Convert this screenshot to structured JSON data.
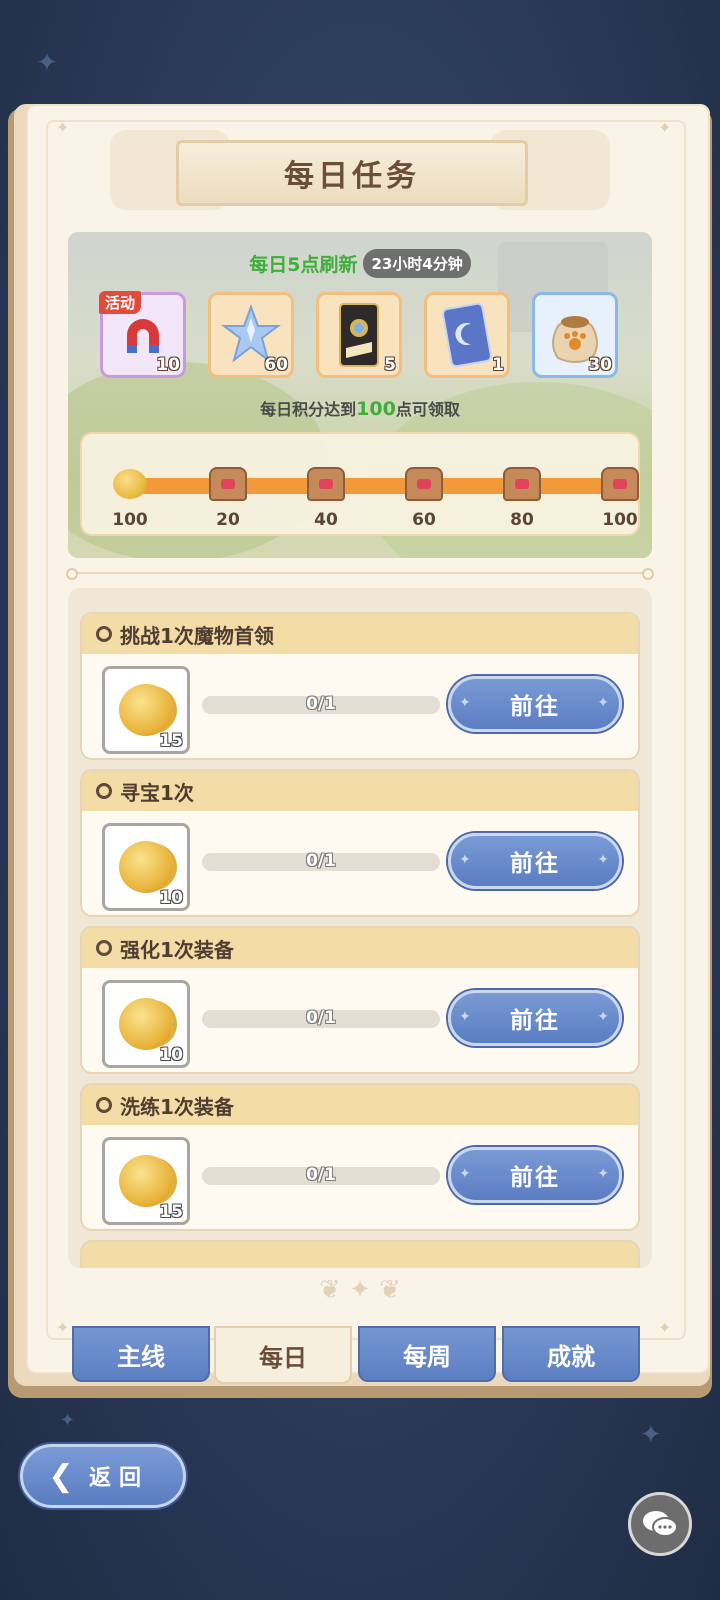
{
  "title": "每日任务",
  "refresh": {
    "text": "每日5点刷新",
    "timer": "23小时4分钟"
  },
  "rewards": [
    {
      "icon": "magnet-icon",
      "count": "10",
      "tag": "活动"
    },
    {
      "icon": "crystal-star-icon",
      "count": "60"
    },
    {
      "icon": "ticket-card-icon",
      "count": "5"
    },
    {
      "icon": "moon-card-icon",
      "count": "1"
    },
    {
      "icon": "paw-bag-icon",
      "count": "30"
    }
  ],
  "claim": {
    "prefix": "每日积分达到",
    "value": "100",
    "suffix": "点可领取"
  },
  "milestones": [
    {
      "label": "100",
      "icon": "coin-icon"
    },
    {
      "label": "20",
      "icon": "chest-icon"
    },
    {
      "label": "40",
      "icon": "chest-icon"
    },
    {
      "label": "60",
      "icon": "chest-icon"
    },
    {
      "label": "80",
      "icon": "chest-icon"
    },
    {
      "label": "100",
      "icon": "chest-icon"
    }
  ],
  "tasks": [
    {
      "title": "挑战1次魔物首领",
      "reward": "15",
      "progress": "0/1",
      "button": "前往"
    },
    {
      "title": "寻宝1次",
      "reward": "10",
      "progress": "0/1",
      "button": "前往"
    },
    {
      "title": "强化1次装备",
      "reward": "10",
      "progress": "0/1",
      "button": "前往"
    },
    {
      "title": "洗练1次装备",
      "reward": "15",
      "progress": "0/1",
      "button": "前往"
    }
  ],
  "tabs": [
    {
      "label": "主线",
      "active": false
    },
    {
      "label": "每日",
      "active": true
    },
    {
      "label": "每周",
      "active": false
    },
    {
      "label": "成就",
      "active": false
    }
  ],
  "back_label": "返回",
  "colors": {
    "accent_blue": "#5c7fc3",
    "green": "#3fae3a",
    "orange": "#f29a3a"
  }
}
